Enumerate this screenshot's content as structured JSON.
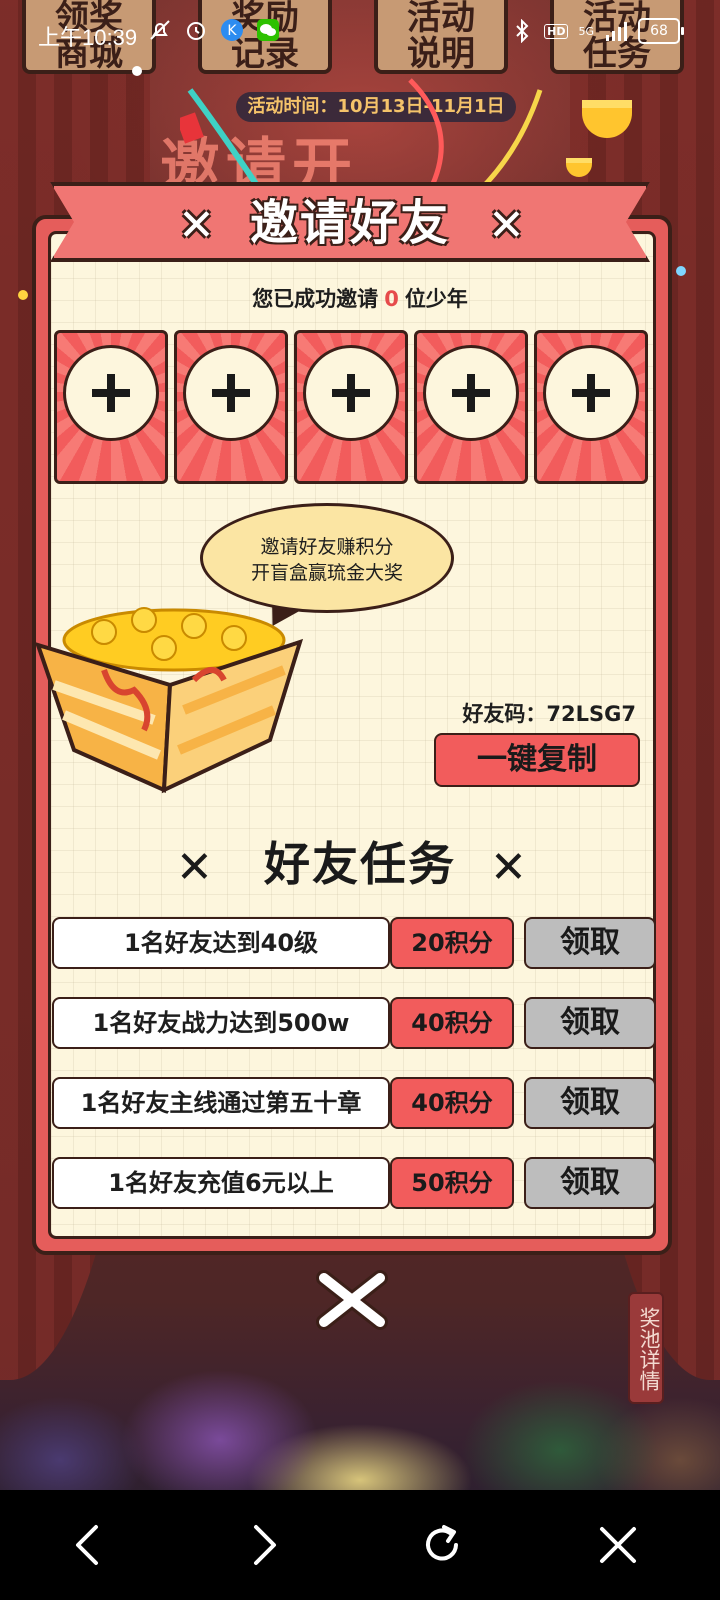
{
  "status_bar": {
    "time": "上午10:39",
    "hd_label": "HD",
    "network_label": "5G",
    "battery_level": "68"
  },
  "background": {
    "top_buttons": [
      "领奖\n商城",
      "奖励\n记录",
      "活动\n说明",
      "活动\n任务"
    ],
    "period": "活动时间：10月13日-11月1日",
    "event_title": "邀请开"
  },
  "invite": {
    "title": "邀请好友",
    "invited_prefix": "您已成功邀请",
    "invited_count": "0",
    "invited_suffix": "位少年",
    "slot_count": 5,
    "bubble_line1": "邀请好友赚积分",
    "bubble_line2": "开盲盒赢琉金大奖",
    "friend_code_label": "好友码：72LSG7",
    "copy_button": "一键复制"
  },
  "tasks": {
    "title": "好友任务",
    "items": [
      {
        "desc": "1名好友达到40级",
        "points": "20积分",
        "action": "领取"
      },
      {
        "desc": "1名好友战力达到500w",
        "points": "40积分",
        "action": "领取"
      },
      {
        "desc": "1名好友主线通过第五十章",
        "points": "40积分",
        "action": "领取"
      },
      {
        "desc": "1名好友充值6元以上",
        "points": "50积分",
        "action": "领取"
      }
    ]
  },
  "pool_button": "奖池详情",
  "colors": {
    "panel_red": "#e55d5b",
    "panel_cream": "#fdf6dd",
    "button_red": "#f25c5c",
    "button_gray": "#bdbdbd",
    "outline": "#3b1f18",
    "count_red": "#e64b4b"
  },
  "nav": {
    "icons": [
      "back-icon",
      "forward-icon",
      "refresh-icon",
      "close-icon"
    ]
  }
}
